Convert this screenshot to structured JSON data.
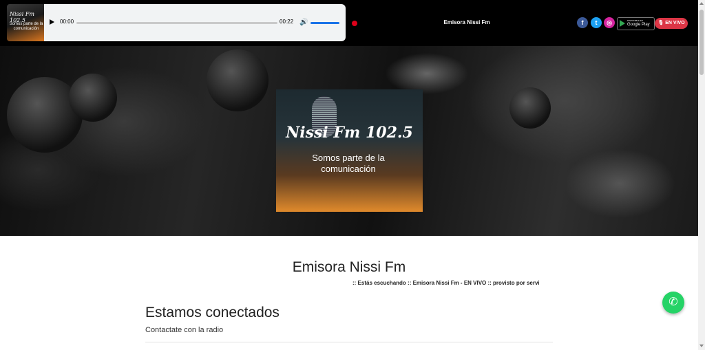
{
  "header": {
    "logo": {
      "title": "Nissi Fm 102.5",
      "subtitle": "Somos parte de la comunicación"
    },
    "player": {
      "current_time": "00:00",
      "duration": "00:22",
      "volume_icon": "speaker-icon"
    },
    "station_title": "Emisora Nissi Fm",
    "social": {
      "facebook": "f",
      "twitter": "t",
      "instagram": "◎"
    },
    "google_play": {
      "small_text": "DISPONIBLE EN",
      "label": "Google Play"
    },
    "live_button": "EN VIVO"
  },
  "hero": {
    "logo_title": "Nissi Fm 102.5",
    "logo_subtitle": "Somos parte de la comunicación"
  },
  "main": {
    "title": "Emisora Nissi Fm",
    "ticker": ":: Estás escuchando :: Emisora Nissi Fm - EN VIVO :: provisto por servi"
  },
  "contact": {
    "title": "Estamos conectados",
    "subtitle": "Contactate con la radio"
  },
  "colors": {
    "live": "#dc3545",
    "whatsapp": "#25d366",
    "player_bg": "#f1f3f4"
  }
}
